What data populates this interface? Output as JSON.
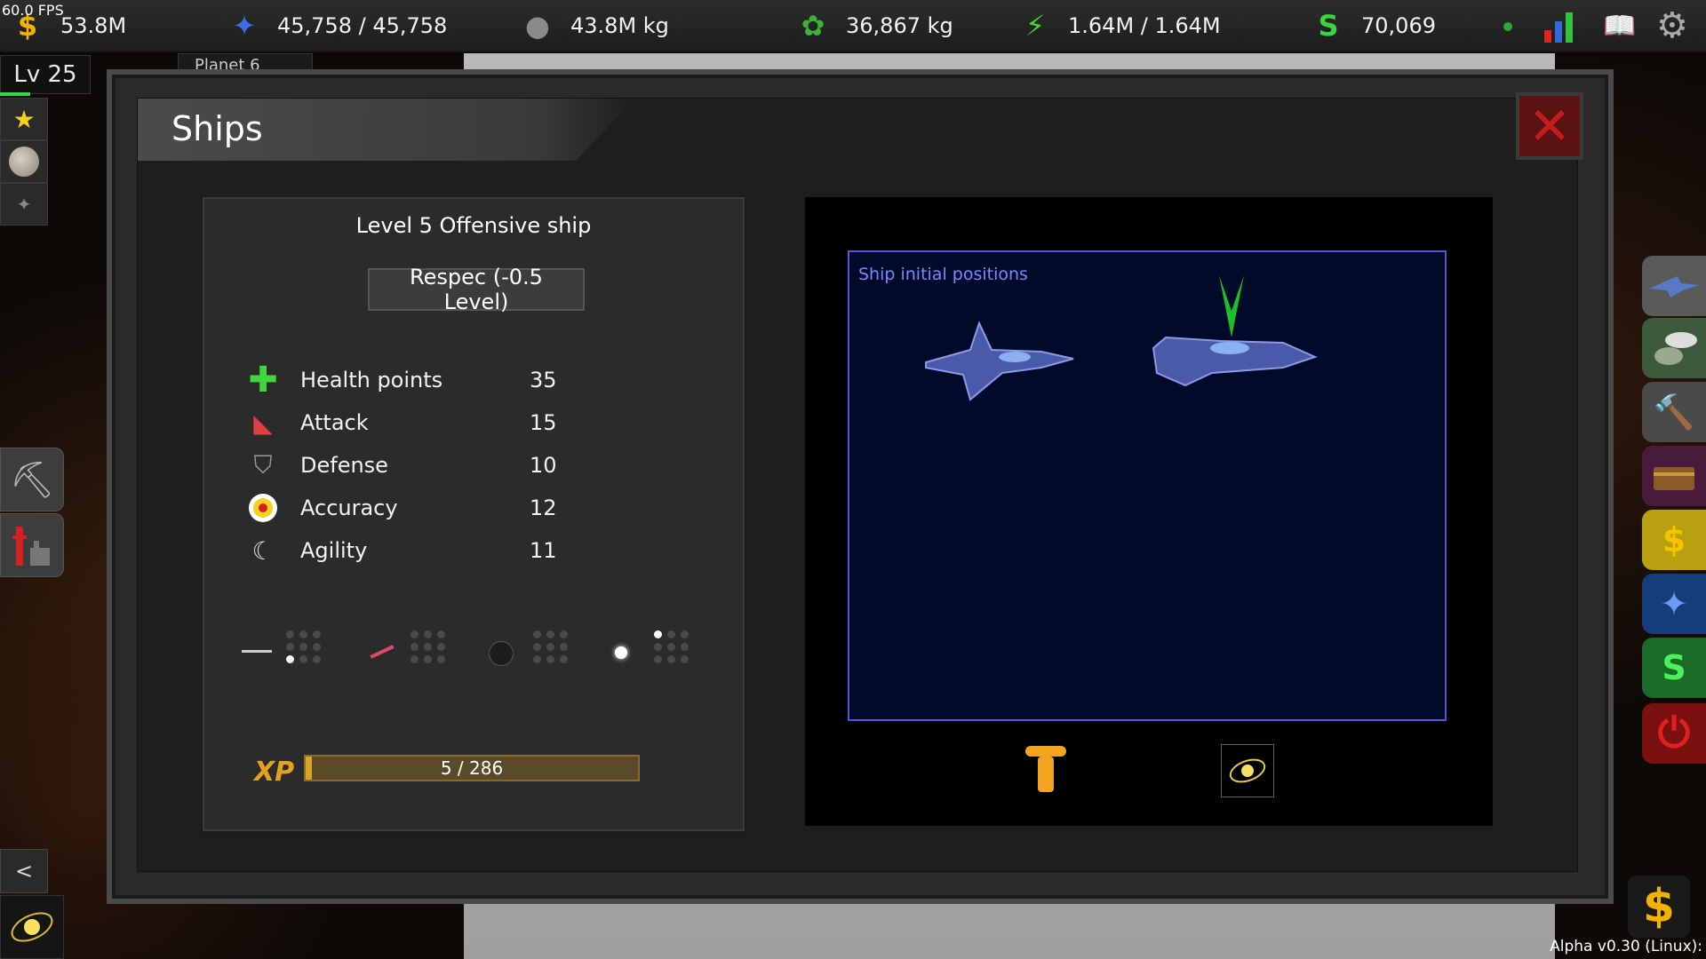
{
  "hud": {
    "fps": "60.0 FPS",
    "money": "53.8M",
    "crystal": "45,758 / 45,758",
    "ore": "43.8M kg",
    "plants": "36,867 kg",
    "energy": "1.64M / 1.64M",
    "credits": "70,069",
    "level": "Lv 25",
    "planet_tab": "Planet 6"
  },
  "dialog": {
    "title": "Ships",
    "ship_title": "Level 5 Offensive ship",
    "respec_label": "Respec (-0.5 Level)",
    "stats": [
      {
        "label": "Health points",
        "value": "35"
      },
      {
        "label": "Attack",
        "value": "15"
      },
      {
        "label": "Defense",
        "value": "10"
      },
      {
        "label": "Accuracy",
        "value": "12"
      },
      {
        "label": "Agility",
        "value": "11"
      }
    ],
    "xp_label": "XP",
    "xp_text": "5 / 286",
    "xp_progress": 0.0175,
    "positions_label": "Ship initial positions"
  },
  "footer": {
    "back_label": "<",
    "version": "Alpha v0.30 (Linux):"
  },
  "colors": {
    "accent_gold": "#e0a31e",
    "positions_border": "#5b52d8",
    "close_red": "#c21e1e"
  }
}
